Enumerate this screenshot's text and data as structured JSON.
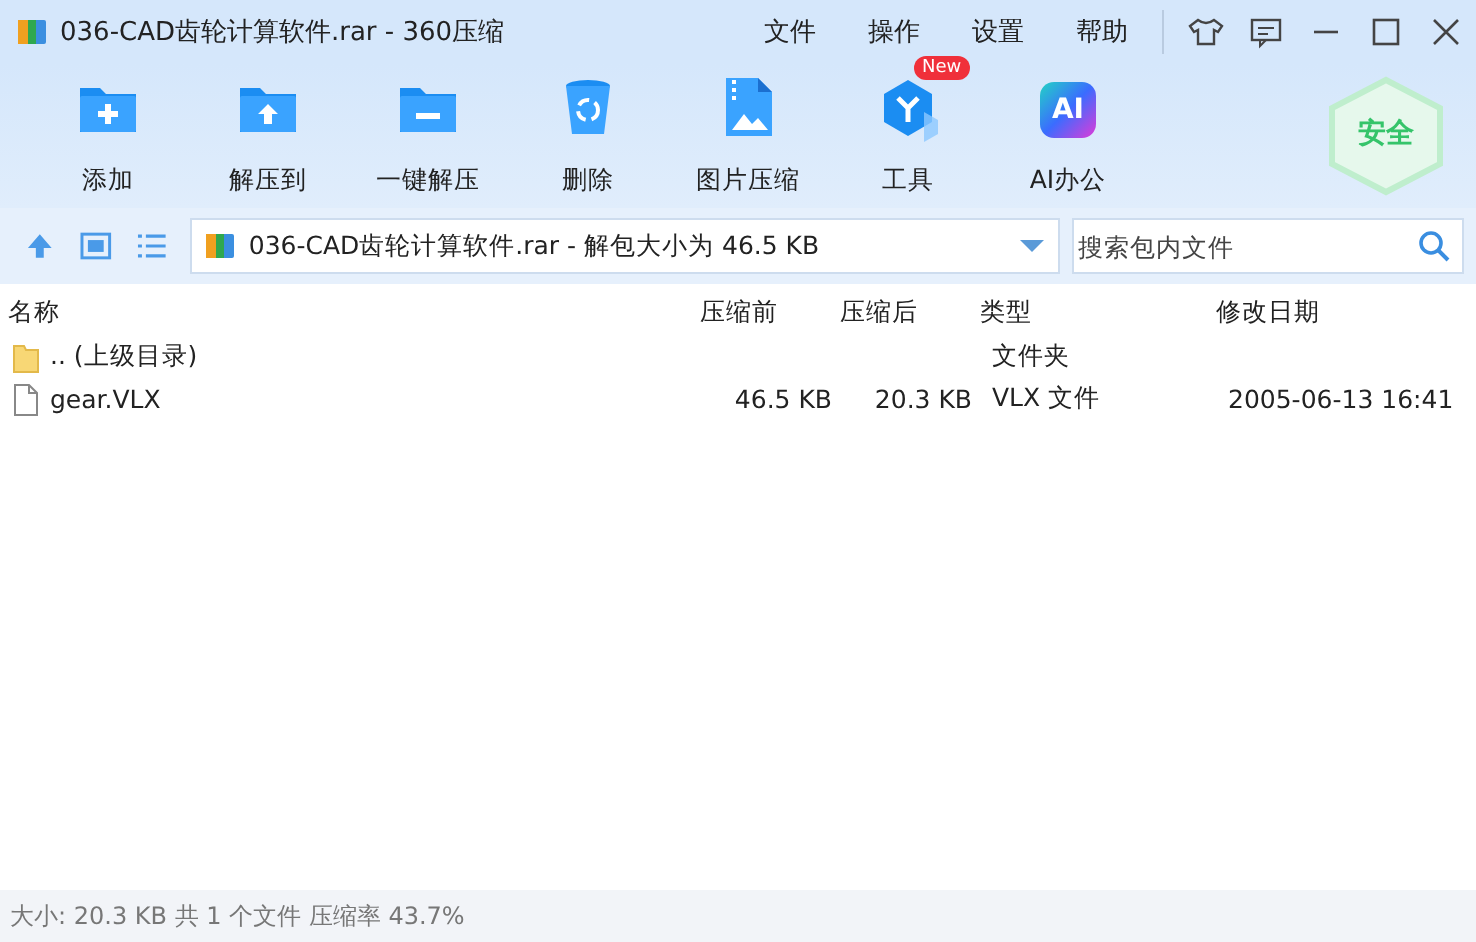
{
  "window": {
    "title": "036-CAD齿轮计算软件.rar - 360压缩",
    "menu": [
      "文件",
      "操作",
      "设置",
      "帮助"
    ]
  },
  "toolbar": [
    {
      "kind": "add",
      "label": "添加"
    },
    {
      "kind": "extract",
      "label": "解压到"
    },
    {
      "kind": "oneclick",
      "label": "一键解压"
    },
    {
      "kind": "delete",
      "label": "删除"
    },
    {
      "kind": "image",
      "label": "图片压缩"
    },
    {
      "kind": "tools",
      "label": "工具",
      "badge": "New"
    },
    {
      "kind": "ai",
      "label": "AI办公",
      "icon_text": "AI"
    }
  ],
  "security": {
    "label": "安全"
  },
  "address": {
    "value": "036-CAD齿轮计算软件.rar - 解包大小为 46.5 KB"
  },
  "search": {
    "placeholder": "搜索包内文件"
  },
  "table": {
    "columns": [
      "名称",
      "压缩前",
      "压缩后",
      "类型",
      "修改日期"
    ],
    "rows": [
      {
        "kind": "folder",
        "name": ".. (上级目录)",
        "type": "文件夹"
      },
      {
        "kind": "file",
        "name": "gear.VLX",
        "size": "46.5 KB",
        "packed": "20.3 KB",
        "type": "VLX 文件",
        "modified": "2005-06-13 16:41"
      }
    ]
  },
  "status_bar": "大小: 20.3 KB 共 1 个文件 压缩率 43.7%"
}
